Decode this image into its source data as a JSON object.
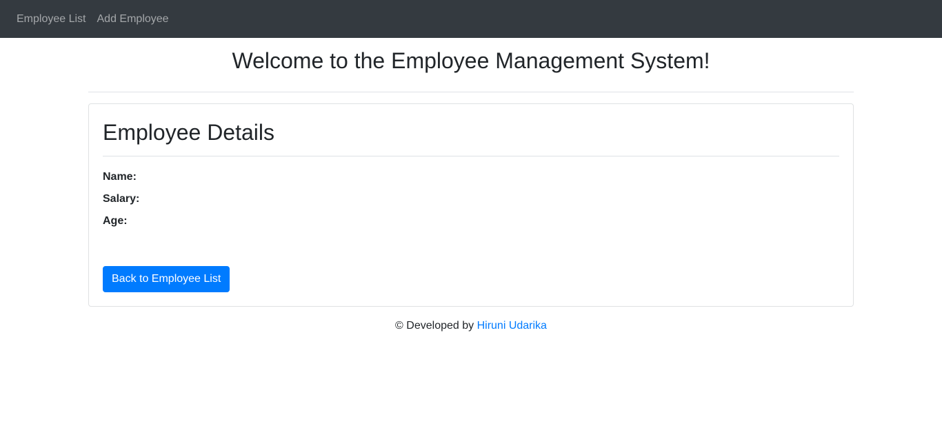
{
  "navbar": {
    "links": [
      {
        "label": "Employee List"
      },
      {
        "label": "Add Employee"
      }
    ]
  },
  "header": {
    "title": "Welcome to the Employee Management System!"
  },
  "card": {
    "title": "Employee Details",
    "fields": {
      "name_label": "Name:",
      "name_value": "",
      "salary_label": "Salary:",
      "salary_value": "",
      "age_label": "Age:",
      "age_value": ""
    },
    "back_button": "Back to Employee List"
  },
  "footer": {
    "prefix": "© Developed by",
    "author": "Hiruni Udarika"
  },
  "colors": {
    "navbar_bg": "#343a40",
    "primary": "#007bff"
  }
}
